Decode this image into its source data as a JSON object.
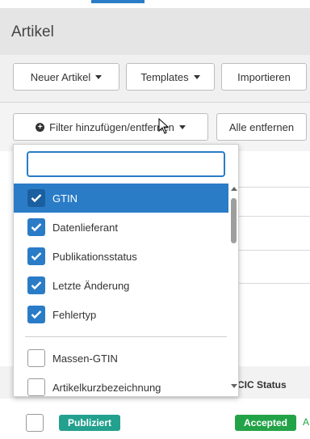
{
  "page": {
    "title": "Artikel"
  },
  "toolbar": {
    "new_article": "Neuer Artikel",
    "templates": "Templates",
    "import": "Importieren"
  },
  "filterbar": {
    "add_remove": "Filter hinzufügen/entfernen",
    "remove_all": "Alle entfernen"
  },
  "dropdown": {
    "search_value": "",
    "items": [
      {
        "label": "GTIN",
        "checked": true,
        "active": true
      },
      {
        "label": "Datenlieferant",
        "checked": true
      },
      {
        "label": "Publikationsstatus",
        "checked": true
      },
      {
        "label": "Letzte Änderung",
        "checked": true
      },
      {
        "label": "Fehlertyp",
        "checked": true
      },
      {
        "label": "Massen-GTIN",
        "checked": false
      },
      {
        "label": "Artikelkurzbezeichnung",
        "checked": false
      }
    ]
  },
  "table": {
    "column_header": "CIC Status",
    "row": {
      "publication_badge": "Publiziert",
      "cic_badge": "Accepted",
      "trailing": "A"
    }
  },
  "colors": {
    "accent": "#2a7cc7",
    "teal": "#23a08e",
    "green": "#23a348"
  }
}
